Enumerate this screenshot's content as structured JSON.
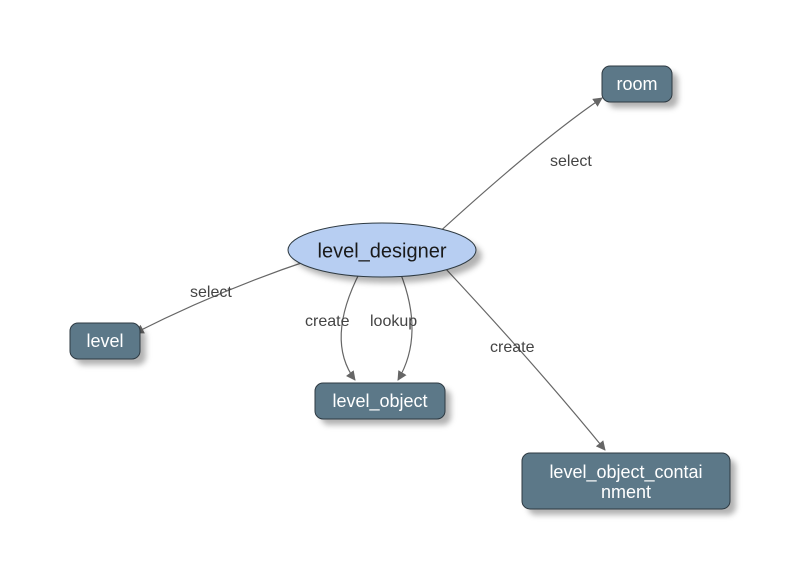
{
  "nodes": {
    "room": {
      "label": "room"
    },
    "level_designer": {
      "label": "level_designer"
    },
    "level": {
      "label": "level"
    },
    "level_object": {
      "label": "level_object"
    },
    "containment": {
      "label": "level_object_contai",
      "label2": "nment"
    }
  },
  "edges": {
    "designer_room": {
      "label": "select"
    },
    "designer_level": {
      "label": "select"
    },
    "designer_obj_create": {
      "label": "create"
    },
    "designer_obj_lookup": {
      "label": "lookup"
    },
    "designer_containment": {
      "label": "create"
    }
  }
}
